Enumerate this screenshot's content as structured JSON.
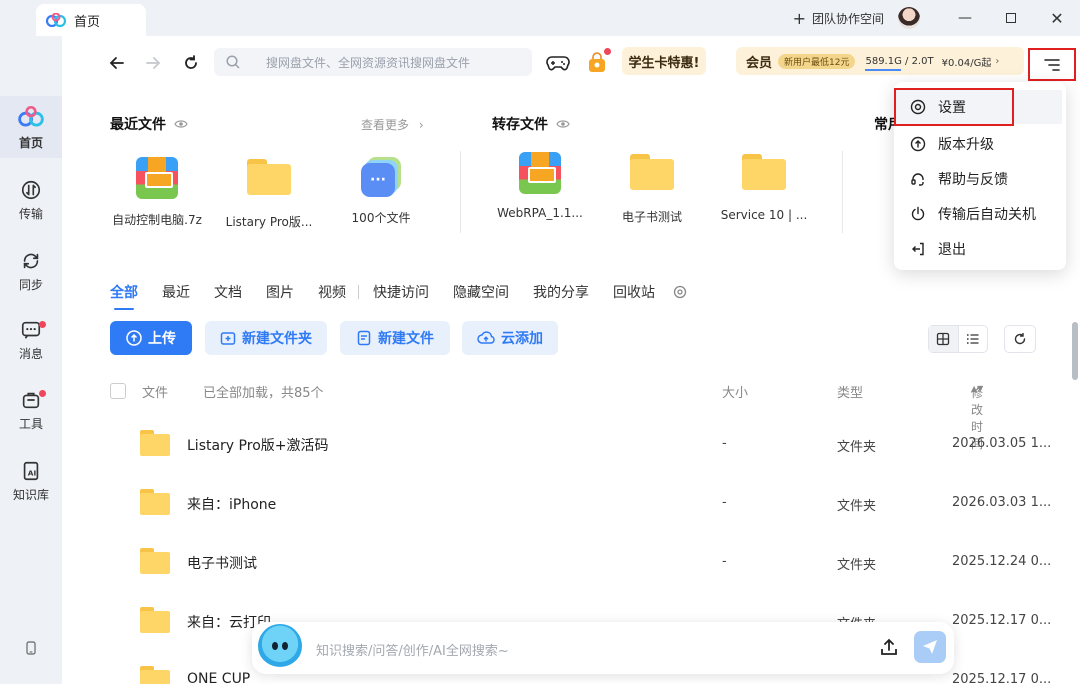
{
  "titlebar": {
    "tab_label": "首页",
    "team_label": "团队协作空间"
  },
  "sidebar": {
    "items": [
      {
        "label": "首页",
        "icon": "baidu-cloud-logo-icon",
        "active": true
      },
      {
        "label": "传输",
        "icon": "transfer-icon"
      },
      {
        "label": "同步",
        "icon": "sync-icon"
      },
      {
        "label": "消息",
        "icon": "message-icon",
        "badge": true
      },
      {
        "label": "工具",
        "icon": "tools-icon",
        "badge": true
      },
      {
        "label": "知识库",
        "icon": "knowledge-base-icon"
      }
    ]
  },
  "toolbar": {
    "search_placeholder": "搜网盘文件、全网资源资讯搜网盘文件",
    "student_label": "学生卡特惠!",
    "member_label": "会员",
    "new_user_label": "新用户最低12元",
    "storage": "589.1G / 2.0T",
    "price": "¥0.04/G起",
    "storage_used_fraction": 0.29
  },
  "recent": {
    "title": "最近文件",
    "see_more": "查看更多",
    "files": [
      {
        "name": "自动控制电脑.7z",
        "icon": "zip"
      },
      {
        "name": "Listary Pro版...",
        "icon": "folder"
      },
      {
        "name": "100个文件",
        "icon": "multi"
      }
    ]
  },
  "saved": {
    "title": "转存文件",
    "files": [
      {
        "name": "WebRPA_1.1...",
        "icon": "zip"
      },
      {
        "name": "电子书测试",
        "icon": "folder"
      },
      {
        "name": "Service 10 | ...",
        "icon": "folder"
      }
    ]
  },
  "common": {
    "title": "常用"
  },
  "tabs": [
    "全部",
    "最近",
    "文档",
    "图片",
    "视频",
    "快捷访问",
    "隐藏空间",
    "我的分享",
    "回收站"
  ],
  "actions": {
    "upload": "上传",
    "new_folder": "新建文件夹",
    "new_file": "新建文件",
    "cloud_add": "云添加"
  },
  "list": {
    "header": {
      "name": "文件",
      "status": "已全部加载，共85个",
      "size": "大小",
      "type": "类型",
      "modified": "修改时间"
    },
    "rows": [
      {
        "name": "Listary Pro版+激活码",
        "size": "-",
        "type": "文件夹",
        "date": "2026.03.05 1..."
      },
      {
        "name": "来自：iPhone",
        "size": "-",
        "type": "文件夹",
        "date": "2026.03.03 1..."
      },
      {
        "name": "电子书测试",
        "size": "-",
        "type": "文件夹",
        "date": "2025.12.24 0..."
      },
      {
        "name": "来自：云打印",
        "size": "",
        "type": "文件夹",
        "date": "2025.12.17 0..."
      },
      {
        "name": "ONE CUP",
        "size": "",
        "type": "",
        "date": "2025.12.17 0..."
      }
    ]
  },
  "ai_bar": {
    "placeholder": "知识搜索/问答/创作/AI全网搜索~"
  },
  "dropdown": {
    "items": [
      {
        "label": "设置",
        "icon": "settings-icon"
      },
      {
        "label": "版本升级",
        "icon": "upgrade-icon"
      },
      {
        "label": "帮助与反馈",
        "icon": "help-headset-icon"
      },
      {
        "label": "传输后自动关机",
        "icon": "power-icon"
      },
      {
        "label": "退出",
        "icon": "logout-icon"
      }
    ]
  },
  "colors": {
    "accent": "#2f7af5",
    "highlight_box": "#e02020",
    "badge": "#f0465b"
  }
}
